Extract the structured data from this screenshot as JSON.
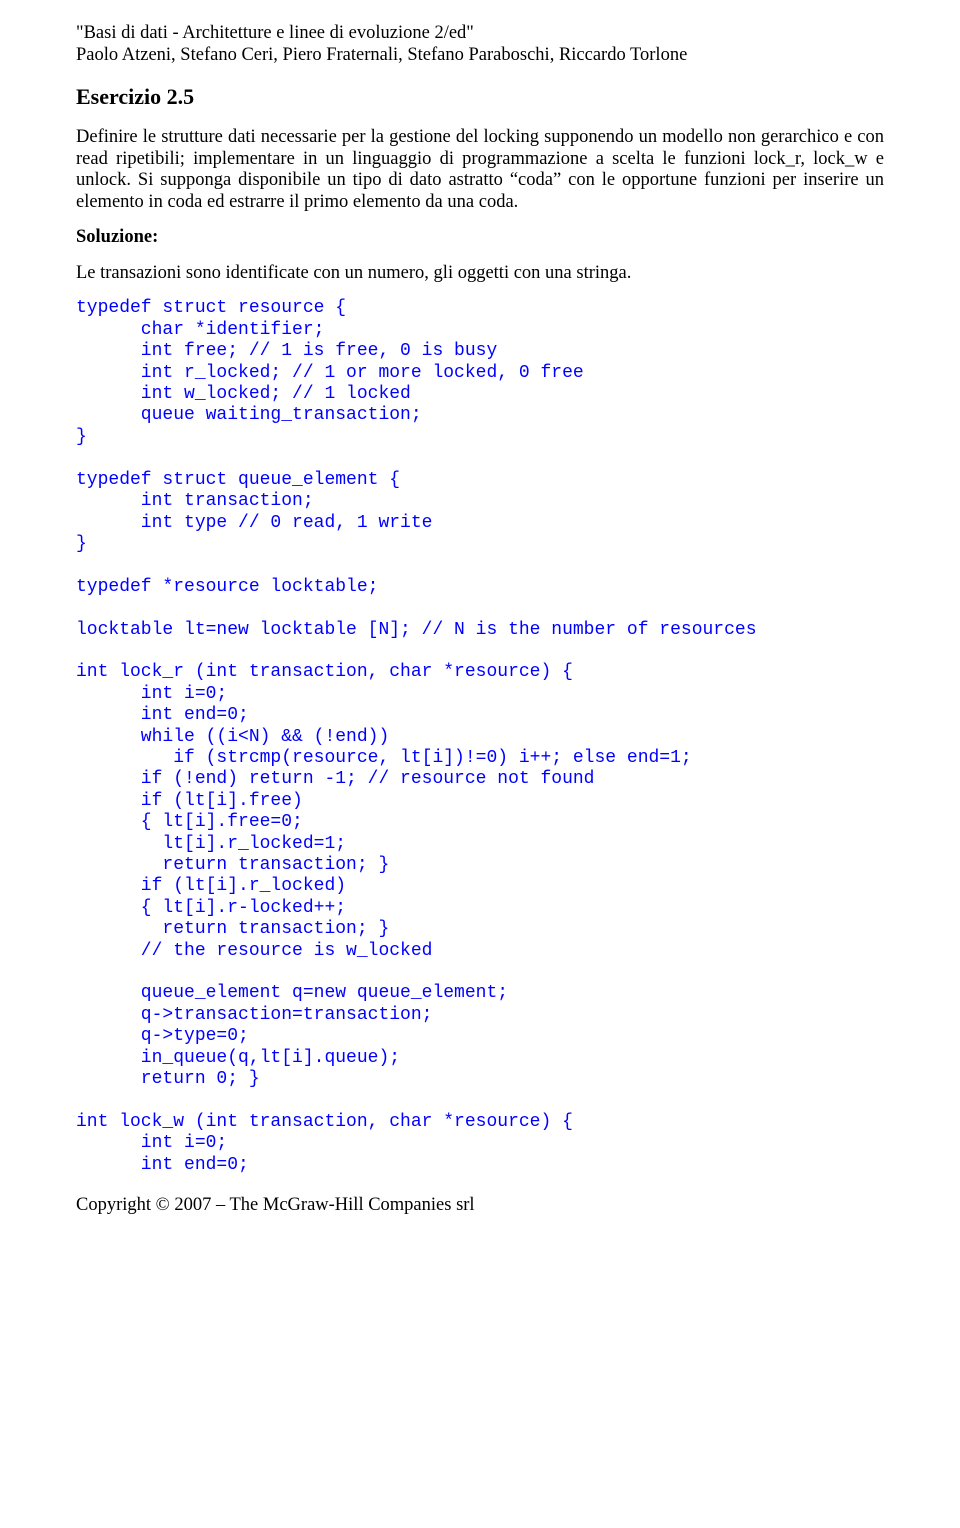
{
  "header": {
    "line1": "Basi di dati - Architetture e linee di evoluzione 2/ed",
    "line2": "Paolo Atzeni, Stefano Ceri, Piero Fraternali, Stefano Paraboschi, Riccardo Torlone"
  },
  "exercise": {
    "title": "Esercizio 2.5",
    "prompt": "Definire le strutture dati necessarie per la gestione del locking supponendo un modello non gerarchico e con read ripetibili; implementare in un linguaggio di programmazione a scelta le funzioni lock_r, lock_w e unlock. Si supponga disponibile un tipo di dato astratto “coda” con le opportune funzioni per inserire un elemento in coda ed estrarre il primo elemento da una coda.",
    "solution_label": "Soluzione:",
    "solution_intro": "Le transazioni sono identificate con un numero, gli oggetti con una stringa."
  },
  "code_blocks": {
    "b1": "typedef struct resource {\n      char *identifier;\n      int free; // 1 is free, 0 is busy\n      int r_locked; // 1 or more locked, 0 free\n      int w_locked; // 1 locked\n      queue waiting_transaction;\n}\n\ntypedef struct queue_element {\n      int transaction;\n      int type // 0 read, 1 write\n}\n\ntypedef *resource locktable;\n\nlocktable lt=new locktable [N]; // N is the number of resources\n\nint lock_r (int transaction, char *resource) {\n      int i=0;\n      int end=0;\n      while ((i<N) && (!end))\n         if (strcmp(resource, lt[i])!=0) i++; else end=1;\n      if (!end) return -1; // resource not found\n      if (lt[i].free)\n      { lt[i].free=0;\n        lt[i].r_locked=1;\n        return transaction; }\n      if (lt[i].r_locked)\n      { lt[i].r-locked++;\n        return transaction; }\n      // the resource is w_locked\n\n      queue_element q=new queue_element;\n      q->transaction=transaction;\n      q->type=0;\n      in_queue(q,lt[i].queue);\n      return 0; }\n\nint lock_w (int transaction, char *resource) {\n      int i=0;\n      int end=0;"
  },
  "footer": {
    "copyright": "Copyright © 2007 – The McGraw-Hill Companies srl"
  }
}
